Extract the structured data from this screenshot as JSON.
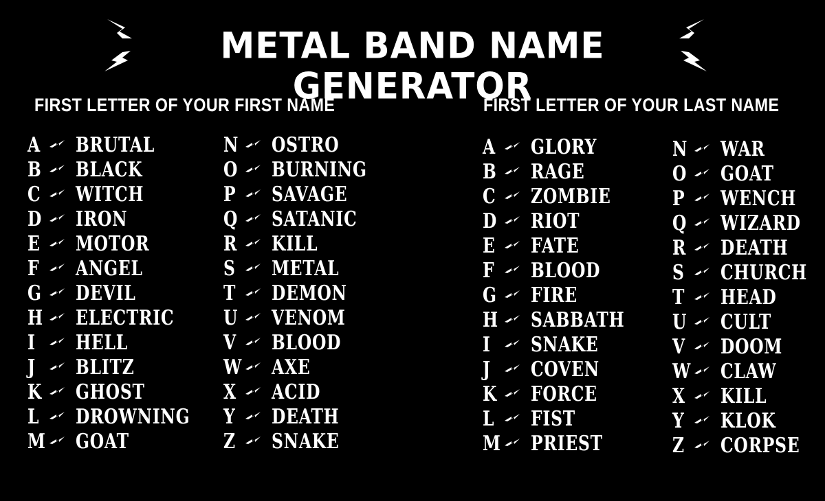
{
  "title": "METAL BAND NAME GENERATOR",
  "decoration": {
    "left_icon": "lightning-bolt-pair",
    "right_icon": "lightning-bolt-pair",
    "separator_icon": "lightning-arrow"
  },
  "first_name": {
    "label": "FIRST LETTER OF YOUR FIRST NAME",
    "columns": [
      [
        {
          "letter": "A",
          "word": "BRUTAL"
        },
        {
          "letter": "B",
          "word": "BLACK"
        },
        {
          "letter": "C",
          "word": "WITCH"
        },
        {
          "letter": "D",
          "word": "IRON"
        },
        {
          "letter": "E",
          "word": "MOTOR"
        },
        {
          "letter": "F",
          "word": "ANGEL"
        },
        {
          "letter": "G",
          "word": "DEVIL"
        },
        {
          "letter": "H",
          "word": "ELECTRIC"
        },
        {
          "letter": "I",
          "word": "HELL"
        },
        {
          "letter": "J",
          "word": "BLITZ"
        },
        {
          "letter": "K",
          "word": "GHOST"
        },
        {
          "letter": "L",
          "word": "DROWNING"
        },
        {
          "letter": "M",
          "word": "GOAT"
        }
      ],
      [
        {
          "letter": "N",
          "word": "OSTRO"
        },
        {
          "letter": "O",
          "word": "BURNING"
        },
        {
          "letter": "P",
          "word": "SAVAGE"
        },
        {
          "letter": "Q",
          "word": "SATANIC"
        },
        {
          "letter": "R",
          "word": "KILL"
        },
        {
          "letter": "S",
          "word": "METAL"
        },
        {
          "letter": "T",
          "word": "DEMON"
        },
        {
          "letter": "U",
          "word": "VENOM"
        },
        {
          "letter": "V",
          "word": "BLOOD"
        },
        {
          "letter": "W",
          "word": "AXE"
        },
        {
          "letter": "X",
          "word": "ACID"
        },
        {
          "letter": "Y",
          "word": "DEATH"
        },
        {
          "letter": "Z",
          "word": "SNAKE"
        }
      ]
    ]
  },
  "last_name": {
    "label": "FIRST LETTER OF YOUR LAST NAME",
    "columns": [
      [
        {
          "letter": "A",
          "word": "GLORY"
        },
        {
          "letter": "B",
          "word": "RAGE"
        },
        {
          "letter": "C",
          "word": "ZOMBIE"
        },
        {
          "letter": "D",
          "word": "RIOT"
        },
        {
          "letter": "E",
          "word": "FATE"
        },
        {
          "letter": "F",
          "word": "BLOOD"
        },
        {
          "letter": "G",
          "word": "FIRE"
        },
        {
          "letter": "H",
          "word": "SABBATH"
        },
        {
          "letter": "I",
          "word": "SNAKE"
        },
        {
          "letter": "J",
          "word": "COVEN"
        },
        {
          "letter": "K",
          "word": "FORCE"
        },
        {
          "letter": "L",
          "word": "FIST"
        },
        {
          "letter": "M",
          "word": "PRIEST"
        }
      ],
      [
        {
          "letter": "N",
          "word": "WAR"
        },
        {
          "letter": "O",
          "word": "GOAT"
        },
        {
          "letter": "P",
          "word": "WENCH"
        },
        {
          "letter": "Q",
          "word": "WIZARD"
        },
        {
          "letter": "R",
          "word": "DEATH"
        },
        {
          "letter": "S",
          "word": "CHURCH"
        },
        {
          "letter": "T",
          "word": "HEAD"
        },
        {
          "letter": "U",
          "word": "CULT"
        },
        {
          "letter": "V",
          "word": "DOOM"
        },
        {
          "letter": "W",
          "word": "CLAW"
        },
        {
          "letter": "X",
          "word": "KILL"
        },
        {
          "letter": "Y",
          "word": "KLOK"
        },
        {
          "letter": "Z",
          "word": "CORPSE"
        }
      ]
    ]
  }
}
